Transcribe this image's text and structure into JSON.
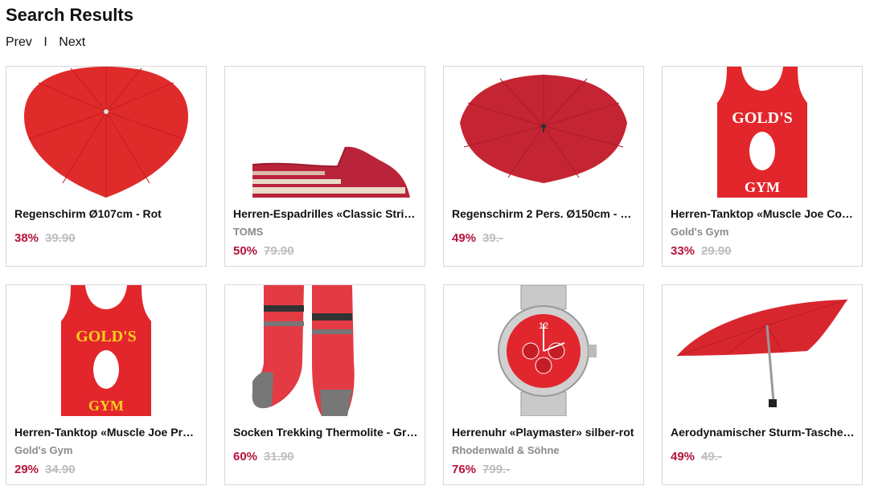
{
  "page": {
    "title": "Search Results"
  },
  "pager": {
    "prev": "Prev",
    "separator": "I",
    "next": "Next"
  },
  "products": [
    {
      "name": "Regenschirm Ø107cm - Rot",
      "brand": "",
      "discount": "38%",
      "old_price": "39.90",
      "image": "heart-umbrella"
    },
    {
      "name": "Herren-Espadrilles «Classic Stri…",
      "brand": "TOMS",
      "discount": "50%",
      "old_price": "79.90",
      "image": "espadrille"
    },
    {
      "name": "Regenschirm 2 Pers. Ø150cm - …",
      "brand": "",
      "discount": "49%",
      "old_price": "39.-",
      "image": "double-umbrella"
    },
    {
      "name": "Herren-Tanktop «Muscle Joe Co…",
      "brand": "Gold's Gym",
      "discount": "33%",
      "old_price": "29.90",
      "image": "tanktop-white-print"
    },
    {
      "name": "Herren-Tanktop «Muscle Joe Pr…",
      "brand": "Gold's Gym",
      "discount": "29%",
      "old_price": "34.90",
      "image": "tanktop-yellow-print"
    },
    {
      "name": "Socken Trekking Thermolite - Gr…",
      "brand": "",
      "discount": "60%",
      "old_price": "31.90",
      "image": "socks"
    },
    {
      "name": "Herrenuhr «Playmaster» silber-rot",
      "brand": "Rhodenwald & Söhne",
      "discount": "76%",
      "old_price": "799.-",
      "image": "watch"
    },
    {
      "name": "Aerodynamischer Sturm-Tasche…",
      "brand": "",
      "discount": "49%",
      "old_price": "49.-",
      "image": "pocket-umbrella"
    }
  ],
  "colors": {
    "discount": "#b5123a",
    "old_price": "#bdbdbd",
    "brand": "#8a8a8a",
    "card_border": "#d8d8d8",
    "product_red": "#d42b2b"
  },
  "image_text": {
    "gym_logo": "GOLD'S",
    "gym_word": "GYM",
    "watch_twelve": "12"
  }
}
